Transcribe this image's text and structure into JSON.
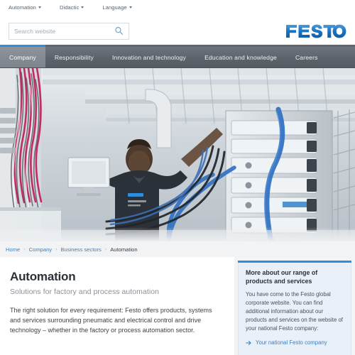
{
  "utility_bar": {
    "items": [
      {
        "label": "Automation",
        "icon": "chevron-down-icon"
      },
      {
        "label": "Didactic",
        "icon": "chevron-down-icon"
      },
      {
        "label": "Language",
        "icon": "chevron-down-icon"
      }
    ]
  },
  "header": {
    "search": {
      "placeholder": "Search website",
      "value": "",
      "icon": "search-icon"
    },
    "logo": {
      "text": "FESTO",
      "color": "#1a74c4"
    }
  },
  "main_nav": {
    "active": "Company",
    "accent_color": "#2f8ddc",
    "items": [
      {
        "label": "Company"
      },
      {
        "label": "Responsibility"
      },
      {
        "label": "Innovation and technology"
      },
      {
        "label": "Education and knowledge"
      },
      {
        "label": "Careers"
      }
    ]
  },
  "hero": {
    "alt": "Technician working on industrial electrical control cabinet with blue pneumatic tubing"
  },
  "breadcrumb": {
    "separator": "›",
    "items": [
      {
        "label": "Home",
        "current": false
      },
      {
        "label": "Company",
        "current": false
      },
      {
        "label": "Business sectors",
        "current": false
      },
      {
        "label": "Automation",
        "current": true
      }
    ]
  },
  "main": {
    "title": "Automation",
    "subtitle": "Solutions for factory and process automation",
    "body": "The right solution for every requirement: Festo offers products, systems and services surrounding pneumatic and electrical control and drive technology – whether in the factory or process automation sector."
  },
  "sidebar": {
    "title": "More about our range of products and services",
    "text": "You have come to the Festo global corporate website. You can find additional information about our products and services on the website of your national Festo company:",
    "link": {
      "label": "Your national Festo company",
      "icon": "arrow-right-icon"
    },
    "accent_color": "#2f8ddc"
  }
}
